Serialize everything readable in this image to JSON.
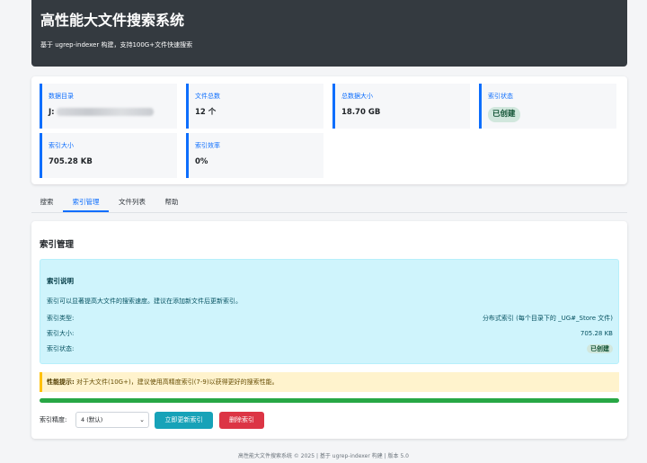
{
  "header": {
    "title": "高性能大文件搜索系统",
    "subtitle": "基于 ugrep-indexer 构建，支持100G+文件快速搜索"
  },
  "stats": [
    {
      "label": "数据目录",
      "value": "J:"
    },
    {
      "label": "文件总数",
      "value": "12 个"
    },
    {
      "label": "总数据大小",
      "value": "18.70 GB"
    },
    {
      "label": "索引状态",
      "value": "已创建"
    },
    {
      "label": "索引大小",
      "value": "705.28 KB"
    },
    {
      "label": "索引效率",
      "value": "0%"
    }
  ],
  "tabs": [
    {
      "label": "搜索",
      "active": false
    },
    {
      "label": "索引管理",
      "active": true
    },
    {
      "label": "文件列表",
      "active": false
    },
    {
      "label": "帮助",
      "active": false
    }
  ],
  "panel": {
    "title": "索引管理",
    "info": {
      "title": "索引说明",
      "description": "索引可以显著提高大文件的搜索速度。建议在添加新文件后更新索引。",
      "rows": [
        {
          "label": "索引类型:",
          "value": "分布式索引 (每个目录下的 _UG#_Store 文件)"
        },
        {
          "label": "索引大小:",
          "value": "705.28 KB"
        },
        {
          "label": "索引状态:",
          "value": "已创建"
        }
      ]
    },
    "warning": {
      "strong": "性能提示:",
      "text": " 对于大文件(10G+)，建议使用高精度索引(7-9)以获得更好的搜索性能。"
    },
    "progress": 1.0,
    "precision_label": "索引精度:",
    "precision_value": "4 (默认)",
    "update_button": "立即更新索引",
    "delete_button": "删除索引"
  },
  "footer": "高性能大文件搜索系统 © 2025 | 基于 ugrep-indexer 构建 | 版本 5.0",
  "colors": {
    "header_bg": "#343a40",
    "accent": "#0d6efd",
    "success": "#28a745",
    "info_btn": "#17a2b8",
    "danger": "#dc3545"
  }
}
